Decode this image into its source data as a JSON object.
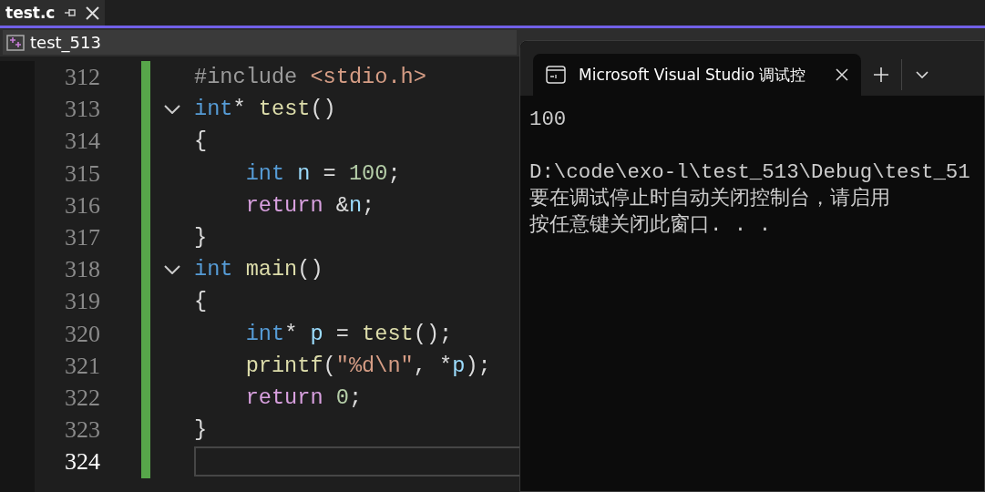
{
  "doc_tab": {
    "label": "test.c",
    "selected": true
  },
  "nav": {
    "project": "test_513"
  },
  "editor": {
    "lines": [
      {
        "number": "312",
        "current": false,
        "fold_toggle": false,
        "tokens": [
          {
            "kind": "preproc",
            "text": "#include "
          },
          {
            "kind": "string",
            "text": "<stdio.h>"
          }
        ]
      },
      {
        "number": "313",
        "current": false,
        "fold_toggle": true,
        "tokens": [
          {
            "kind": "keyword",
            "text": "int"
          },
          {
            "kind": "plain",
            "text": "* "
          },
          {
            "kind": "func",
            "text": "test"
          },
          {
            "kind": "plain",
            "text": "()"
          }
        ]
      },
      {
        "number": "314",
        "current": false,
        "fold_toggle": false,
        "tokens": [
          {
            "kind": "plain",
            "text": "{"
          }
        ]
      },
      {
        "number": "315",
        "current": false,
        "fold_toggle": false,
        "tokens": [
          {
            "kind": "keyword",
            "text": "    int"
          },
          {
            "kind": "var",
            "text": " n"
          },
          {
            "kind": "plain",
            "text": " = "
          },
          {
            "kind": "number",
            "text": "100"
          },
          {
            "kind": "plain",
            "text": ";"
          }
        ]
      },
      {
        "number": "316",
        "current": false,
        "fold_toggle": false,
        "tokens": [
          {
            "kind": "control",
            "text": "    return"
          },
          {
            "kind": "plain",
            "text": " &"
          },
          {
            "kind": "var",
            "text": "n"
          },
          {
            "kind": "plain",
            "text": ";"
          }
        ]
      },
      {
        "number": "317",
        "current": false,
        "fold_toggle": false,
        "tokens": [
          {
            "kind": "plain",
            "text": "}"
          }
        ]
      },
      {
        "number": "318",
        "current": false,
        "fold_toggle": true,
        "tokens": [
          {
            "kind": "keyword",
            "text": "int"
          },
          {
            "kind": "func",
            "text": " main"
          },
          {
            "kind": "plain",
            "text": "()"
          }
        ]
      },
      {
        "number": "319",
        "current": false,
        "fold_toggle": false,
        "tokens": [
          {
            "kind": "plain",
            "text": "{"
          }
        ]
      },
      {
        "number": "320",
        "current": false,
        "fold_toggle": false,
        "tokens": [
          {
            "kind": "keyword",
            "text": "    int"
          },
          {
            "kind": "plain",
            "text": "* "
          },
          {
            "kind": "var",
            "text": "p"
          },
          {
            "kind": "plain",
            "text": " = "
          },
          {
            "kind": "func",
            "text": "test"
          },
          {
            "kind": "plain",
            "text": "();"
          }
        ]
      },
      {
        "number": "321",
        "current": false,
        "fold_toggle": false,
        "tokens": [
          {
            "kind": "func",
            "text": "    printf"
          },
          {
            "kind": "plain",
            "text": "("
          },
          {
            "kind": "string",
            "text": "\"%d\\n\""
          },
          {
            "kind": "plain",
            "text": ", *"
          },
          {
            "kind": "var",
            "text": "p"
          },
          {
            "kind": "plain",
            "text": ");"
          }
        ]
      },
      {
        "number": "322",
        "current": false,
        "fold_toggle": false,
        "tokens": [
          {
            "kind": "control",
            "text": "    return"
          },
          {
            "kind": "number",
            "text": " 0"
          },
          {
            "kind": "plain",
            "text": ";"
          }
        ]
      },
      {
        "number": "323",
        "current": false,
        "fold_toggle": false,
        "tokens": [
          {
            "kind": "plain",
            "text": "}"
          }
        ]
      },
      {
        "number": "324",
        "current": true,
        "fold_toggle": false
      }
    ]
  },
  "console": {
    "tab_title": "Microsoft Visual Studio 调试控",
    "output": [
      {
        "lines": [
          "100"
        ]
      },
      {
        "lines": [
          "D:\\code\\exo-l\\test_513\\Debug\\test_51",
          "要在调试停止时自动关闭控制台，请启用",
          "按任意键关闭此窗口. . ."
        ]
      }
    ]
  }
}
